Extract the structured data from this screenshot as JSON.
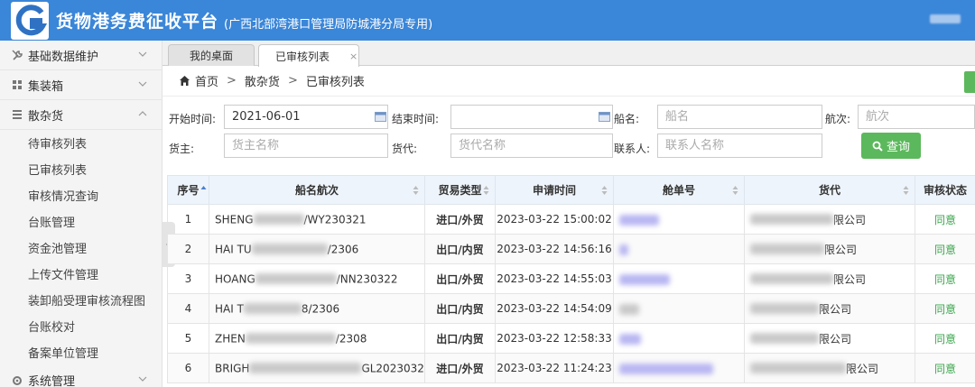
{
  "header": {
    "title": "货物港务费征收平台",
    "subtitle": "(广西北部湾港口管理局防城港分局专用)"
  },
  "sidebar": {
    "groups": [
      {
        "label": "基础数据维护",
        "icon": "wrench-icon",
        "expanded": false
      },
      {
        "label": "集装箱",
        "icon": "grid-icon",
        "expanded": false
      },
      {
        "label": "散杂货",
        "icon": "list-icon",
        "expanded": true
      }
    ],
    "items": [
      "待审核列表",
      "已审核列表",
      "审核情况查询",
      "台账管理",
      "资金池管理",
      "上传文件管理",
      "装卸船受理审核流程图",
      "台账校对",
      "备案单位管理"
    ],
    "bottom_group": {
      "label": "系统管理"
    }
  },
  "tabs": {
    "desktop": "我的桌面",
    "audited": "已审核列表",
    "close_glyph": "×"
  },
  "breadcrumb": {
    "home": "首页",
    "sep": ">",
    "section": "散杂货",
    "current": "已审核列表"
  },
  "search": {
    "start_label": "开始时间:",
    "start_value": "2021-06-01",
    "end_label": "结束时间:",
    "end_value": "",
    "ship_label": "船名:",
    "ship_placeholder": "船名",
    "voyage_label": "航次:",
    "voyage_placeholder": "航次",
    "owner_label": "货主:",
    "owner_placeholder": "货主名称",
    "agent_label": "货代:",
    "agent_placeholder": "货代名称",
    "contact_label": "联系人:",
    "contact_placeholder": "联系人名称",
    "query_label": "查询"
  },
  "table": {
    "headers": [
      "序号",
      "船名航次",
      "贸易类型",
      "申请时间",
      "舱单号",
      "货代",
      "审核状态"
    ],
    "rows": [
      {
        "no": "1",
        "ship_prefix": "SHENG",
        "ship_suffix": "/WY230321",
        "trade": "进口/外贸",
        "time": "2023-03-22 15:00:02",
        "agent_suffix": "限公司",
        "status": "同意"
      },
      {
        "no": "2",
        "ship_prefix": "HAI TU",
        "ship_suffix": "/2306",
        "trade": "出口/内贸",
        "time": "2023-03-22 14:56:16",
        "agent_suffix": "限公司",
        "status": "同意"
      },
      {
        "no": "3",
        "ship_prefix": "HOANG",
        "ship_suffix": "/NN230322",
        "trade": "出口/外贸",
        "time": "2023-03-22 14:55:03",
        "agent_suffix": "限公司",
        "status": "同意"
      },
      {
        "no": "4",
        "ship_prefix": "HAI T",
        "ship_suffix": "8/2306",
        "trade": "出口/内贸",
        "time": "2023-03-22 14:54:09",
        "agent_suffix": "限公司",
        "status": "同意"
      },
      {
        "no": "5",
        "ship_prefix": "ZHEN",
        "ship_suffix": "/2308",
        "trade": "出口/内贸",
        "time": "2023-03-22 12:58:33",
        "agent_suffix": "限公司",
        "status": "同意"
      },
      {
        "no": "6",
        "ship_prefix": "BRIGH",
        "ship_suffix": "GL20230323",
        "trade": "进口/外贸",
        "time": "2023-03-22 11:24:23",
        "agent_suffix": "限公司",
        "status": "同意"
      }
    ]
  },
  "colors": {
    "header_bg": "#3a86d8",
    "query_button": "#5cb85c",
    "status_green": "#3aa54c",
    "table_header_bg": "#eef4fb"
  }
}
